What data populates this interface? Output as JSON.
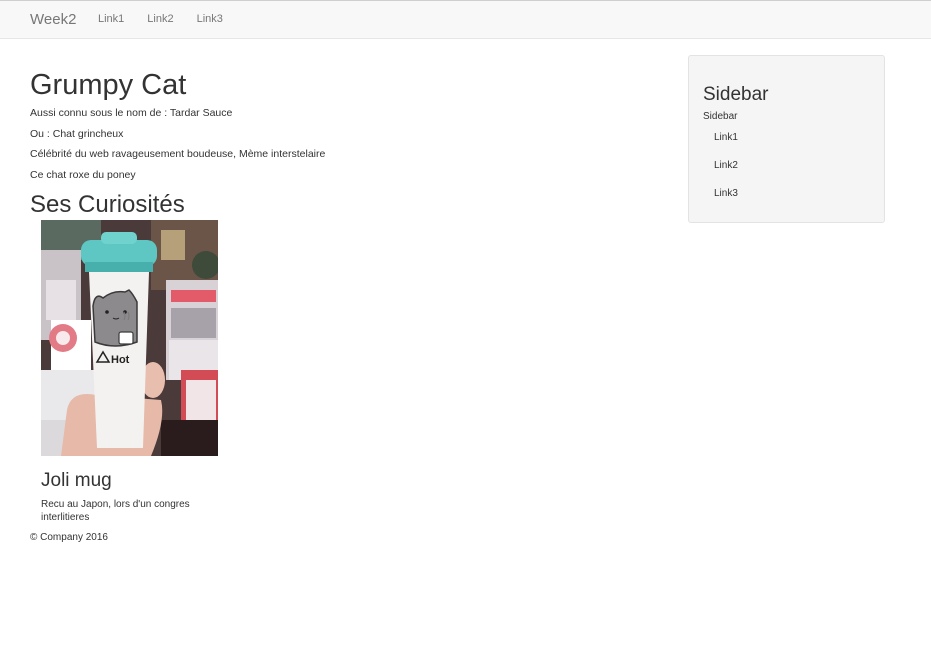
{
  "navbar": {
    "brand": "Week2",
    "links": [
      "Link1",
      "Link2",
      "Link3"
    ]
  },
  "main": {
    "title": "Grumpy Cat",
    "paragraphs": [
      "Aussi connu sous le nom de : Tardar Sauce",
      "Ou : Chat grincheux",
      "Célébrité du web ravageusement boudeuse, Mème interstelaire",
      "Ce chat roxe du poney"
    ],
    "section_title": "Ses Curiosités",
    "card": {
      "title": "Joli mug",
      "text": "Recu au Japon, lors d'un congres interlitieres",
      "mug_text": "Hot"
    },
    "footer": "© Company 2016"
  },
  "sidebar": {
    "title": "Sidebar",
    "subtitle": "Sidebar",
    "links": [
      "Link1",
      "Link2",
      "Link3"
    ]
  }
}
